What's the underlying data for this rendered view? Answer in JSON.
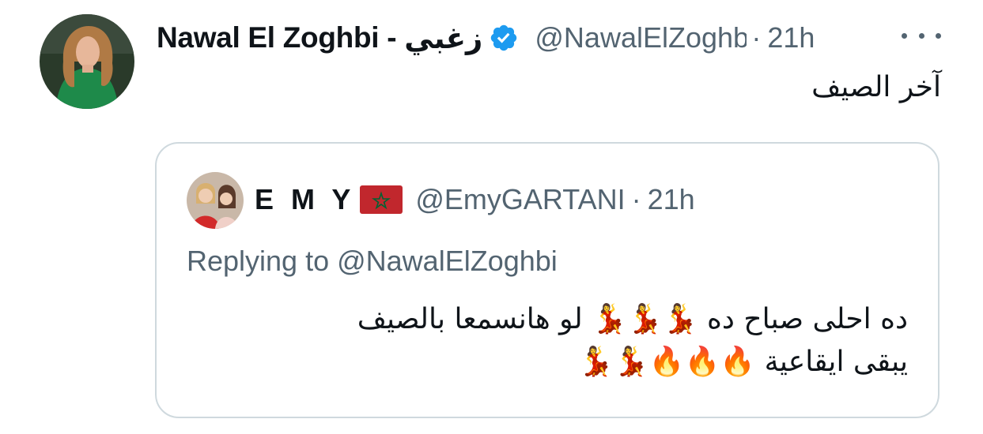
{
  "tweet": {
    "author_name": "Nawal El Zoghbi -",
    "author_name_ar": "زغبي",
    "handle": "@NawalElZoghbi",
    "separator": "·",
    "time": "21h",
    "text": "آخر الصيف",
    "verified_icon": "verified-badge-icon",
    "more_icon": "more-options-icon",
    "colors": {
      "verified": "#1d9bf0",
      "secondary_text": "#536471",
      "primary_text": "#0f1419",
      "border": "#cfd9de"
    }
  },
  "quote": {
    "author_name": "E M Y",
    "flag_icon": "morocco-flag-icon",
    "handle": "@EmyGARTANI",
    "separator": "·",
    "time": "21h",
    "replying_to": "Replying to @NawalElZoghbi",
    "text_line1": "ده احلى صباح ده 💃💃💃 لو هانسمعا بالصيف",
    "text_line2": "يبقى ايقاعية 🔥🔥🔥💃💃"
  }
}
